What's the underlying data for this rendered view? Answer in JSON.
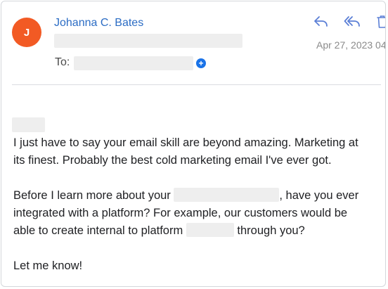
{
  "colors": {
    "avatar_bg": "#f25a24",
    "accent": "#2b6cc4",
    "icon_blue": "#5b7fd6",
    "icon_gray": "#6f7780"
  },
  "header": {
    "avatar_initial": "J",
    "sender_name": "Johanna C. Bates",
    "to_label": "To:",
    "date": "Apr 27, 2023 04",
    "actions": [
      {
        "name": "reply-icon"
      },
      {
        "name": "reply-all-icon"
      },
      {
        "name": "trash-icon"
      }
    ],
    "add_recipient_icon": "plus-icon"
  },
  "message": {
    "line1": "I just have to say your email skill are beyond amazing. Marketing at",
    "line2": "its finest. Probably the best cold marketing email I've ever got.",
    "line3_a": "Before I learn more about your",
    "line3_b": ", have you ever",
    "line4": "integrated with a platform? For example, our customers would be",
    "line5_a": "able to create internal to platform",
    "line5_b": "through you?",
    "signoff": "Let me know!"
  }
}
